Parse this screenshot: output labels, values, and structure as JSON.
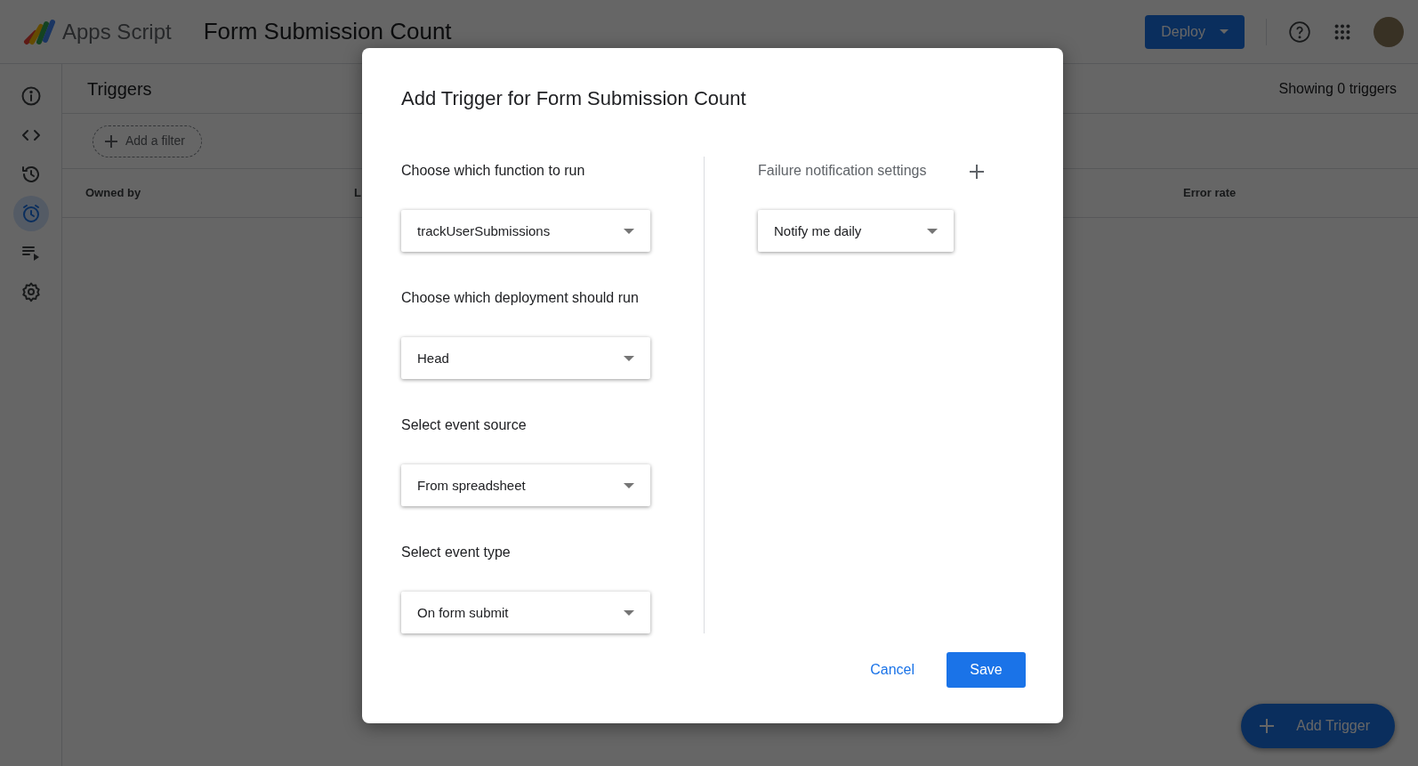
{
  "app_bar": {
    "product_name": "Apps Script",
    "project_title": "Form Submission Count",
    "deploy_button": "Deploy"
  },
  "sidebar": {
    "items": [
      {
        "kind": "info",
        "selected": false
      },
      {
        "kind": "code",
        "selected": false
      },
      {
        "kind": "history",
        "selected": false
      },
      {
        "kind": "triggers",
        "selected": true
      },
      {
        "kind": "executions",
        "selected": false
      },
      {
        "kind": "settings",
        "selected": false
      }
    ]
  },
  "page": {
    "title": "Triggers",
    "count": "Showing 0 triggers",
    "filter_button": "Add a filter",
    "columns": [
      "Owned by",
      "L",
      "Error rate"
    ],
    "fab": "Add Trigger"
  },
  "dialog": {
    "title": "Add Trigger for Form Submission Count",
    "fields": [
      {
        "label": "Choose which function to run",
        "value": "trackUserSubmissions"
      },
      {
        "label": "Choose which deployment should run",
        "value": "Head"
      },
      {
        "label": "Select event source",
        "value": "From spreadsheet"
      },
      {
        "label": "Select event type",
        "value": "On form submit"
      }
    ],
    "failure_settings": {
      "label": "Failure notification settings",
      "value": "Notify me daily"
    },
    "buttons": {
      "cancel": "Cancel",
      "save": "Save"
    }
  }
}
